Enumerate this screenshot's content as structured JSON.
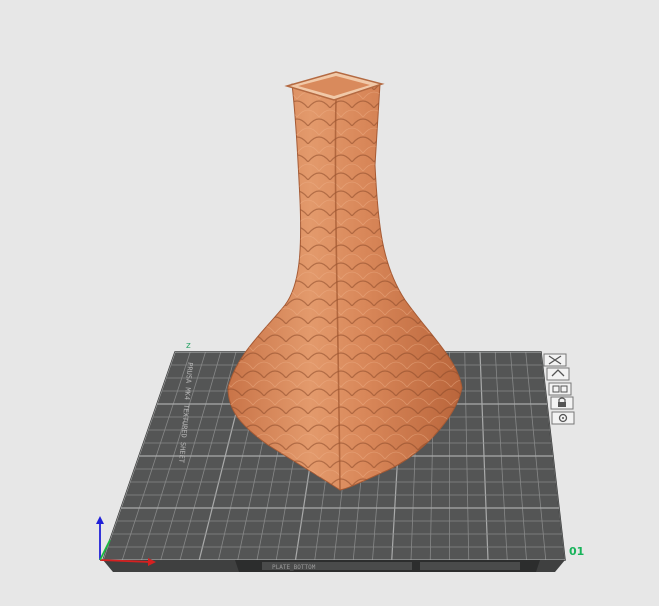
{
  "viewport": {
    "background": "#e7e7e7",
    "plate_number": "01",
    "plate_number_color": "#17b35a",
    "plate_side_label": "PRUSA MK4 TEXTURED SHEET",
    "plate_bottom_label": "PLATE_BOTTOM",
    "axis_y_label": "z",
    "axis_colors": {
      "x": "#d62020",
      "y": "#18b840",
      "z": "#2020d8"
    },
    "model_color": "#d8865a",
    "plate_color": "#545555"
  },
  "plate_icons": [
    {
      "name": "delete-icon",
      "glyph": "✕"
    },
    {
      "name": "orient-icon",
      "glyph": "⟲"
    },
    {
      "name": "arrange-icon",
      "glyph": "▦"
    },
    {
      "name": "lock-icon",
      "glyph": "🔒"
    },
    {
      "name": "settings-icon",
      "glyph": "⚙"
    }
  ]
}
